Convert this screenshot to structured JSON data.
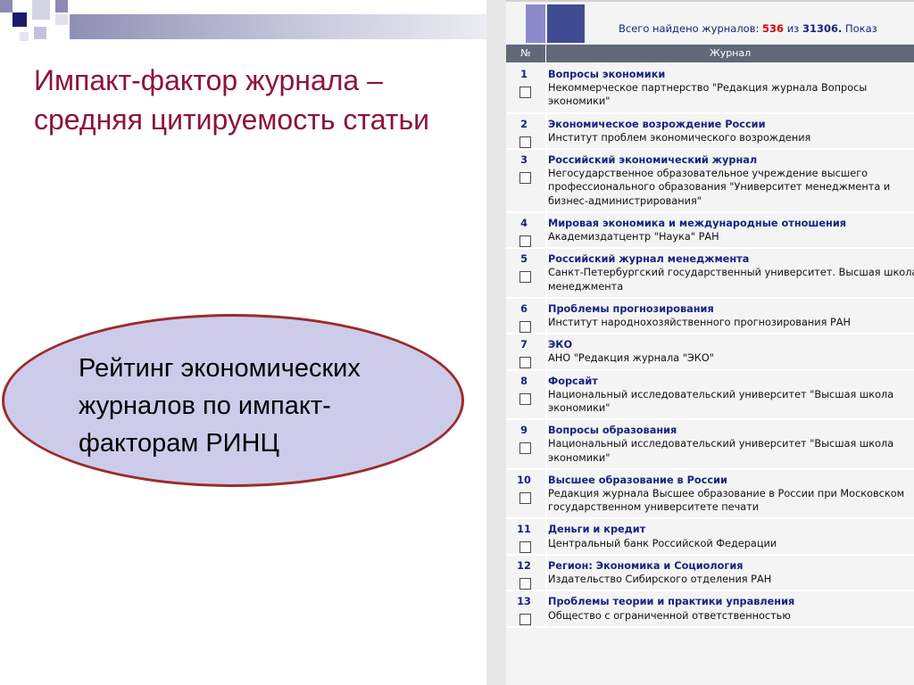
{
  "slide": {
    "title": "Импакт-фактор журнала – средняя цитируемость статьи",
    "callout": "Рейтинг экономических журналов по импакт-факторам РИНЦ"
  },
  "screenshot": {
    "found_prefix": "Всего найдено журналов:",
    "found_count": "536",
    "found_of": "из",
    "found_total": "31306.",
    "found_suffix": "Показ",
    "table_headers": {
      "num": "№",
      "journal": "Журнал"
    },
    "rows": [
      {
        "num": "1",
        "title": "Вопросы экономики",
        "publisher": "Некоммерческое партнерство \"Редакция журнала Вопросы экономики\""
      },
      {
        "num": "2",
        "title": "Экономическое возрождение России",
        "publisher": "Институт проблем экономического возрождения"
      },
      {
        "num": "3",
        "title": "Российский экономический журнал",
        "publisher": "Негосударственное образовательное учреждение высшего профессионального образования \"Университет менеджмента и бизнес-администрирования\""
      },
      {
        "num": "4",
        "title": "Мировая экономика и международные отношения",
        "publisher": "Академиздатцентр \"Наука\" РАН"
      },
      {
        "num": "5",
        "title": "Российский журнал менеджмента",
        "publisher": "Санкт-Петербургский государственный университет. Высшая школа менеджмента"
      },
      {
        "num": "6",
        "title": "Проблемы прогнозирования",
        "publisher": "Институт народнохозяйственного прогнозирования РАН"
      },
      {
        "num": "7",
        "title": "ЭКО",
        "publisher": "АНО \"Редакция журнала \"ЭКО\""
      },
      {
        "num": "8",
        "title": "Форсайт",
        "publisher": "Национальный исследовательский университет \"Высшая школа экономики\""
      },
      {
        "num": "9",
        "title": "Вопросы образования",
        "publisher": "Национальный исследовательский университет \"Высшая школа экономики\""
      },
      {
        "num": "10",
        "title": "Высшее образование в России",
        "publisher": "Редакция журнала Высшее образование в России при Московском государственном университете печати"
      },
      {
        "num": "11",
        "title": "Деньги и кредит",
        "publisher": "Центральный банк Российской Федерации"
      },
      {
        "num": "12",
        "title": "Регион: Экономика и Социология",
        "publisher": "Издательство Сибирского отделения РАН"
      },
      {
        "num": "13",
        "title": "Проблемы теории и практики управления",
        "publisher": "Общество с ограниченной ответственностью"
      }
    ]
  },
  "colors": {
    "title": "#8c1438",
    "ellipse_fill": "#ccccea",
    "ellipse_border": "#9c2b2b",
    "journal_title": "#1a237e",
    "count_highlight": "#d40000",
    "table_header_bg": "#61687a"
  }
}
